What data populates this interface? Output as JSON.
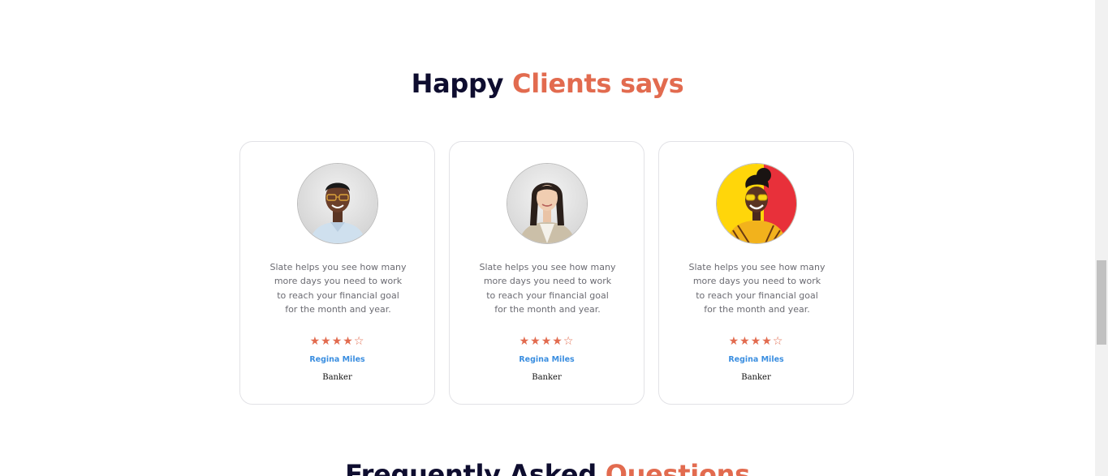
{
  "testimonials_section": {
    "title_part1": "Happy",
    "title_part2": "Clients says",
    "cards": [
      {
        "quote": "Slate helps you see how many more days you need to work to reach your financial goal for the month and year.",
        "rating": 4,
        "rating_max": 5,
        "name": "Regina Miles",
        "role": "Banker",
        "avatar": "person-portrait-man-glasses"
      },
      {
        "quote": "Slate helps you see how many more days you need to work to reach your financial goal for the month and year.",
        "rating": 4,
        "rating_max": 5,
        "name": "Regina Miles",
        "role": "Banker",
        "avatar": "person-portrait-woman-cardigan"
      },
      {
        "quote": "Slate helps you see how many more days you need to work to reach your financial goal for the month and year.",
        "rating": 4,
        "rating_max": 5,
        "name": "Regina Miles",
        "role": "Banker",
        "avatar": "person-portrait-woman-yellow-sunglasses"
      }
    ]
  },
  "faq_section": {
    "title_part1": "Frequently Asked",
    "title_part2": "Questions"
  },
  "colors": {
    "heading_dark": "#0e0d2f",
    "accent": "#e26b4f",
    "name_link": "#3a8ee0",
    "body_text": "#6b6b72",
    "card_border": "#e2e2e6"
  }
}
